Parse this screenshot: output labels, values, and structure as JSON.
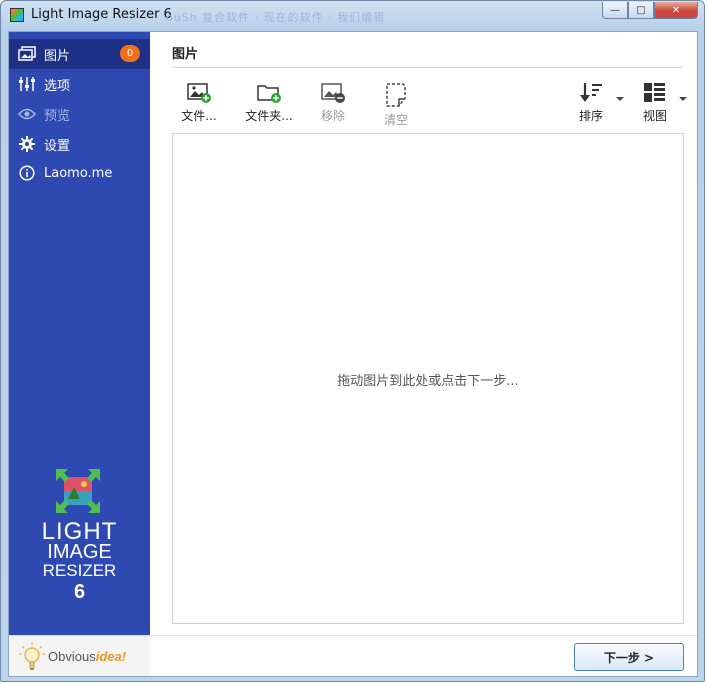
{
  "window": {
    "title": "Light Image Resizer 6",
    "faded_title": "ouSh - 复合的软件 - 现在的软件 - 我们的编辑器",
    "buttons": {
      "minimize": "—",
      "maximize": "□",
      "close": "✕"
    }
  },
  "sidebar": {
    "items": [
      {
        "label": "图片",
        "icon": "images-icon",
        "badge": "0",
        "active": true,
        "disabled": false
      },
      {
        "label": "选项",
        "icon": "sliders-icon",
        "active": false,
        "disabled": false
      },
      {
        "label": "预览",
        "icon": "eye-icon",
        "active": false,
        "disabled": true
      },
      {
        "label": "设置",
        "icon": "gear-icon",
        "active": false,
        "disabled": false
      },
      {
        "label": "Laomo.me",
        "icon": "info-icon",
        "active": false,
        "disabled": false
      }
    ],
    "logo": {
      "line1": "LIGHT",
      "line2": "IMAGE",
      "line3": "RESIZER",
      "line4": "6"
    },
    "brand": {
      "prefix": "Obvious",
      "accent": "idea!"
    }
  },
  "main": {
    "title": "图片",
    "toolbar": [
      {
        "label": "文件...",
        "icon": "add-image-icon",
        "disabled": false
      },
      {
        "label": "文件夹...",
        "icon": "add-folder-icon",
        "disabled": false
      },
      {
        "label": "移除",
        "icon": "remove-image-icon",
        "disabled": true
      },
      {
        "label": "清空",
        "icon": "clear-icon",
        "disabled": true
      },
      {
        "label": "排序",
        "icon": "sort-icon",
        "disabled": false
      },
      {
        "label": "视图",
        "icon": "view-icon",
        "disabled": false
      }
    ],
    "drop_hint": "拖动图片到此处或点击下一步...",
    "next_button": "下一步 >"
  },
  "colors": {
    "sidebar_bg": "#2f49b3",
    "sidebar_active": "#1e3187",
    "badge": "#f26f1a",
    "add_green": "#2ea52e"
  }
}
